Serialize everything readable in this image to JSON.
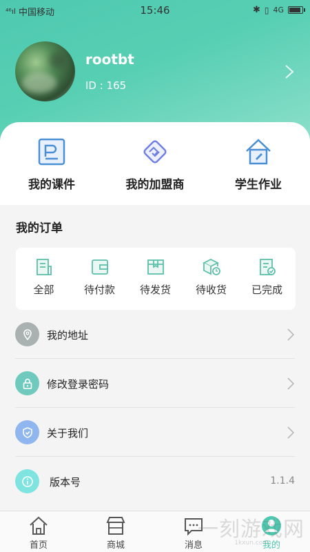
{
  "status_bar": {
    "signal": "⁴⁶ıl",
    "carrier": "中国移动",
    "time": "15:46",
    "network": "4G",
    "battery_level": 0.95
  },
  "profile": {
    "username": "rootbt",
    "id_text": "ID : 165"
  },
  "quick_actions": [
    {
      "label": "我的课件",
      "icon": "courseware-icon"
    },
    {
      "label": "我的加盟商",
      "icon": "handshake-icon"
    },
    {
      "label": "学生作业",
      "icon": "homework-icon"
    }
  ],
  "orders": {
    "title": "我的订单",
    "items": [
      {
        "label": "全部",
        "icon": "all-orders-icon"
      },
      {
        "label": "待付款",
        "icon": "wallet-icon"
      },
      {
        "label": "待发货",
        "icon": "box-icon"
      },
      {
        "label": "待收货",
        "icon": "delivery-icon"
      },
      {
        "label": "已完成",
        "icon": "completed-icon"
      }
    ]
  },
  "menu": [
    {
      "label": "我的地址",
      "icon": "location-icon",
      "color": "#a9b2b1"
    },
    {
      "label": "修改登录密码",
      "icon": "lock-icon",
      "color": "#6fc9bd"
    },
    {
      "label": "关于我们",
      "icon": "shield-icon",
      "color": "#8fb6ef"
    },
    {
      "label": "版本号",
      "icon": "info-icon",
      "color": "#7fe3e0",
      "value": "1.1.4"
    }
  ],
  "tabbar": [
    {
      "label": "首页",
      "icon": "home-icon"
    },
    {
      "label": "商城",
      "icon": "store-icon"
    },
    {
      "label": "消息",
      "icon": "message-icon"
    },
    {
      "label": "我的",
      "icon": "profile-icon",
      "active": true
    }
  ],
  "watermark": {
    "text": "一刻游戏网",
    "url": "1kxun.com"
  },
  "colors": {
    "accent": "#4ec9b0",
    "header_gradient_end": "#8fe0cb",
    "icon_blue": "#4a8fd6",
    "icon_purple": "#6f7fe6"
  }
}
